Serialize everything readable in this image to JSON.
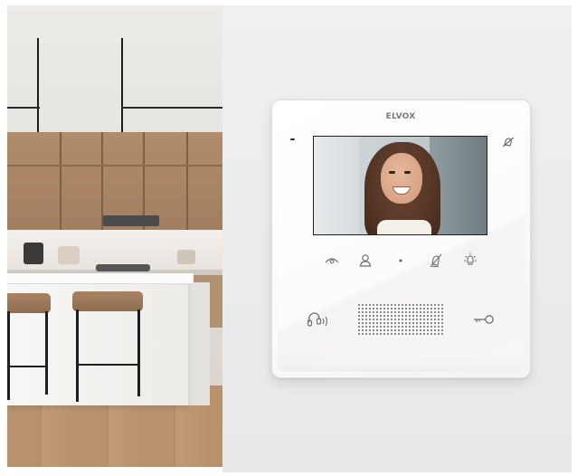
{
  "brand": {
    "logo_text": "ELVOX"
  },
  "scene": {
    "left_photo": "kitchen",
    "device_screen": "smiling-woman-video"
  },
  "device": {
    "buttons_row1": [
      "eye-icon",
      "user-icon",
      "dot-icon",
      "mute-icon",
      "light-icon"
    ],
    "buttons_row2": [
      "handset-icon",
      "key-icon"
    ],
    "top_right_icon": "bell-mute-icon"
  }
}
